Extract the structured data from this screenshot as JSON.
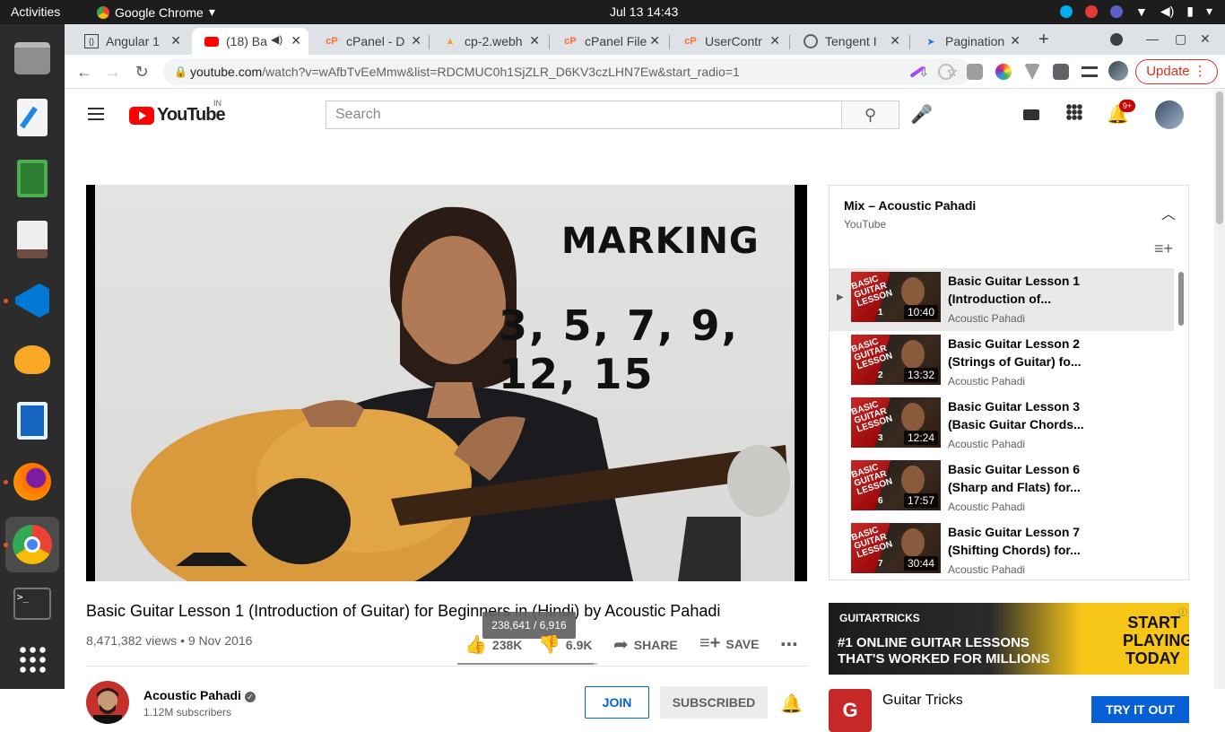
{
  "topbar": {
    "activities": "Activities",
    "app_name": "Google Chrome",
    "clock": "Jul 13  14:43"
  },
  "tabs": [
    {
      "title": "Angular 1",
      "icon": "angular-icon",
      "color": "#3c4043"
    },
    {
      "title": "(18) Ba",
      "icon": "youtube-icon",
      "color": "#ff0000",
      "active": true
    },
    {
      "title": "cPanel - D",
      "icon": "cpanel-icon",
      "color": "#ff6c2c"
    },
    {
      "title": "cp-2.webh",
      "icon": "webhost-icon",
      "color": "#f0a030"
    },
    {
      "title": "cPanel File",
      "icon": "cpanel-icon",
      "color": "#ff6c2c"
    },
    {
      "title": "UserContr",
      "icon": "cpanel-icon",
      "color": "#ff6c2c"
    },
    {
      "title": "Tengent I",
      "icon": "globe-icon",
      "color": "#5f6368"
    },
    {
      "title": "Pagination",
      "icon": "send-icon",
      "color": "#1a73e8"
    }
  ],
  "omnibox": {
    "host": "youtube.com",
    "path": "/watch?v=wAfbTvEeMmw&list=RDCMUC0h1SjZLR_D6KV3czLHN7Ew&start_radio=1"
  },
  "update_label": "Update",
  "yt": {
    "region": "IN",
    "logo_text": "YouTube",
    "search_placeholder": "Search",
    "notif_count": "9+"
  },
  "video": {
    "overlay_title": "MARKING",
    "overlay_numbers": "3, 5, 7, 9, 12, 15",
    "title": "Basic Guitar Lesson 1 (Introduction of Guitar) for Beginners in (Hindi) by Acoustic Pahadi",
    "views": "8,471,382 views • 9 Nov 2016",
    "tooltip": "238,641 / 6,916",
    "likes": "238K",
    "dislikes": "6.9K",
    "like_ratio": 0.972,
    "share_label": "SHARE",
    "save_label": "SAVE",
    "channel_name": "Acoustic Pahadi",
    "channel_subs": "1.12M subscribers",
    "join_label": "JOIN",
    "subscribed_label": "SUBSCRIBED"
  },
  "playlist": {
    "title": "Mix – Acoustic Pahadi",
    "subtitle": "YouTube",
    "items": [
      {
        "line1": "Basic Guitar Lesson 1",
        "line2": "(Introduction of...",
        "channel": "Acoustic Pahadi",
        "duration": "10:40",
        "thumb_num": "1",
        "current": true
      },
      {
        "line1": "Basic Guitar Lesson 2",
        "line2": "(Strings of Guitar) fo...",
        "channel": "Acoustic Pahadi",
        "duration": "13:32",
        "thumb_num": "2"
      },
      {
        "line1": "Basic Guitar Lesson 3",
        "line2": "(Basic Guitar Chords...",
        "channel": "Acoustic Pahadi",
        "duration": "12:24",
        "thumb_num": "3"
      },
      {
        "line1": "Basic Guitar Lesson 6",
        "line2": "(Sharp and Flats) for...",
        "channel": "Acoustic Pahadi",
        "duration": "17:57",
        "thumb_num": "6"
      },
      {
        "line1": "Basic Guitar Lesson 7",
        "line2": "(Shifting Chords) for...",
        "channel": "Acoustic Pahadi",
        "duration": "30:44",
        "thumb_num": "7"
      }
    ],
    "thumb_label": "BASIC GUITAR LESSON"
  },
  "ad": {
    "brand": "GUITARTRICKS",
    "line1": "#1 ONLINE GUITAR LESSONS",
    "line2": "THAT'S WORKED FOR MILLIONS",
    "cta": "START PLAYING TODAY",
    "advertiser": "Guitar Tricks",
    "button": "TRY IT OUT"
  }
}
